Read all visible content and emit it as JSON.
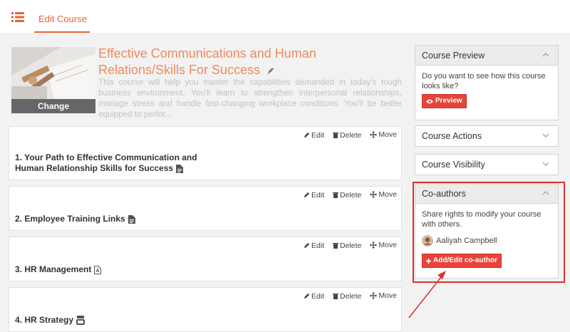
{
  "header": {
    "tab_label": "Edit Course",
    "menu_icon": "list-icon",
    "accent_color": "#e8633a"
  },
  "course": {
    "title": "Effective Communications and Human Relations/Skills For Success",
    "description": "This course will help you master the capabilities demanded in today's tough business environment. You'll learn to strengthen interpersonal relationships, manage stress and handle fast-changing workplace conditions. You'll be better equipped to perfor...",
    "change_label": "Change"
  },
  "lesson_actions": {
    "edit": "Edit",
    "delete": "Delete",
    "move": "Move"
  },
  "lessons": [
    {
      "title_line1": "1. Your Path to Effective Communication and",
      "title_line2": "Human Relationship Skills for Success",
      "icon": "document-icon"
    },
    {
      "title": "2. Employee Training Links",
      "icon": "document-icon"
    },
    {
      "title": "3. HR Management",
      "icon": "pdf-icon"
    },
    {
      "title": "4. HR Strategy",
      "icon": "youtube-icon"
    }
  ],
  "sidebar": {
    "preview": {
      "title": "Course Preview",
      "text": "Do you want to see how this course looks like?",
      "button": "Preview"
    },
    "actions": {
      "title": "Course Actions"
    },
    "visibility": {
      "title": "Course Visibility"
    },
    "coauthors": {
      "title": "Co-authors",
      "text": "Share rights to modify your course with others.",
      "author_name": "Aaliyah Campbell",
      "button": "Add/Edit co-author"
    }
  },
  "colors": {
    "highlight": "#e02f2f",
    "button_red": "#e8433a"
  }
}
